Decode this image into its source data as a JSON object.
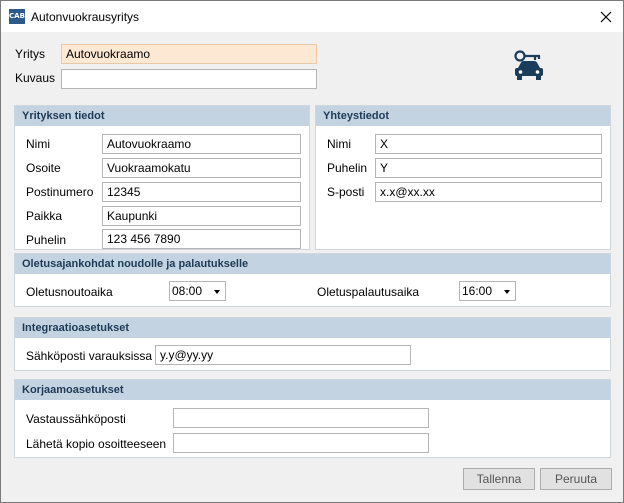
{
  "window": {
    "title": "Autonvuokrausyritys",
    "app_icon_text": "CAB"
  },
  "company": {
    "name_label": "Yritys",
    "name_value": "Autovuokraamo",
    "description_label": "Kuvaus",
    "description_value": "",
    "logo_icon": "car-key-icon",
    "logo_color": "#1a3d5c"
  },
  "company_info": {
    "header": "Yrityksen tiedot",
    "fields": [
      {
        "label": "Nimi",
        "value": "Autovuokraamo"
      },
      {
        "label": "Osoite",
        "value": "Vuokraamokatu"
      },
      {
        "label": "Postinumero",
        "value": "12345"
      },
      {
        "label": "Paikka",
        "value": "Kaupunki"
      },
      {
        "label": "Puhelin",
        "value": "123 456 7890"
      }
    ]
  },
  "contact": {
    "header": "Yhteystiedot",
    "fields": [
      {
        "label": "Nimi",
        "value": "X"
      },
      {
        "label": "Puhelin",
        "value": "Y"
      },
      {
        "label": "S-posti",
        "value": "x.x@xx.xx"
      }
    ]
  },
  "default_times": {
    "header": "Oletusajankohdat noudolle ja palautukselle",
    "pickup_label": "Oletusnoutoaika",
    "pickup_value": "08:00",
    "return_label": "Oletuspalautusaika",
    "return_value": "16:00"
  },
  "integration": {
    "header": "Integraatioasetukset",
    "email_label": "Sähköposti varauksissa",
    "email_value": "y.y@yy.yy"
  },
  "repair": {
    "header": "Korjaamoasetukset",
    "reply_label": "Vastaussähköposti",
    "reply_value": "",
    "copy_label": "Lähetä kopio osoitteeseen",
    "copy_value": ""
  },
  "footer": {
    "save_label": "Tallenna",
    "cancel_label": "Peruuta"
  },
  "colors": {
    "section_header": "#c3d3e1",
    "highlight_field": "#fde8d3"
  }
}
